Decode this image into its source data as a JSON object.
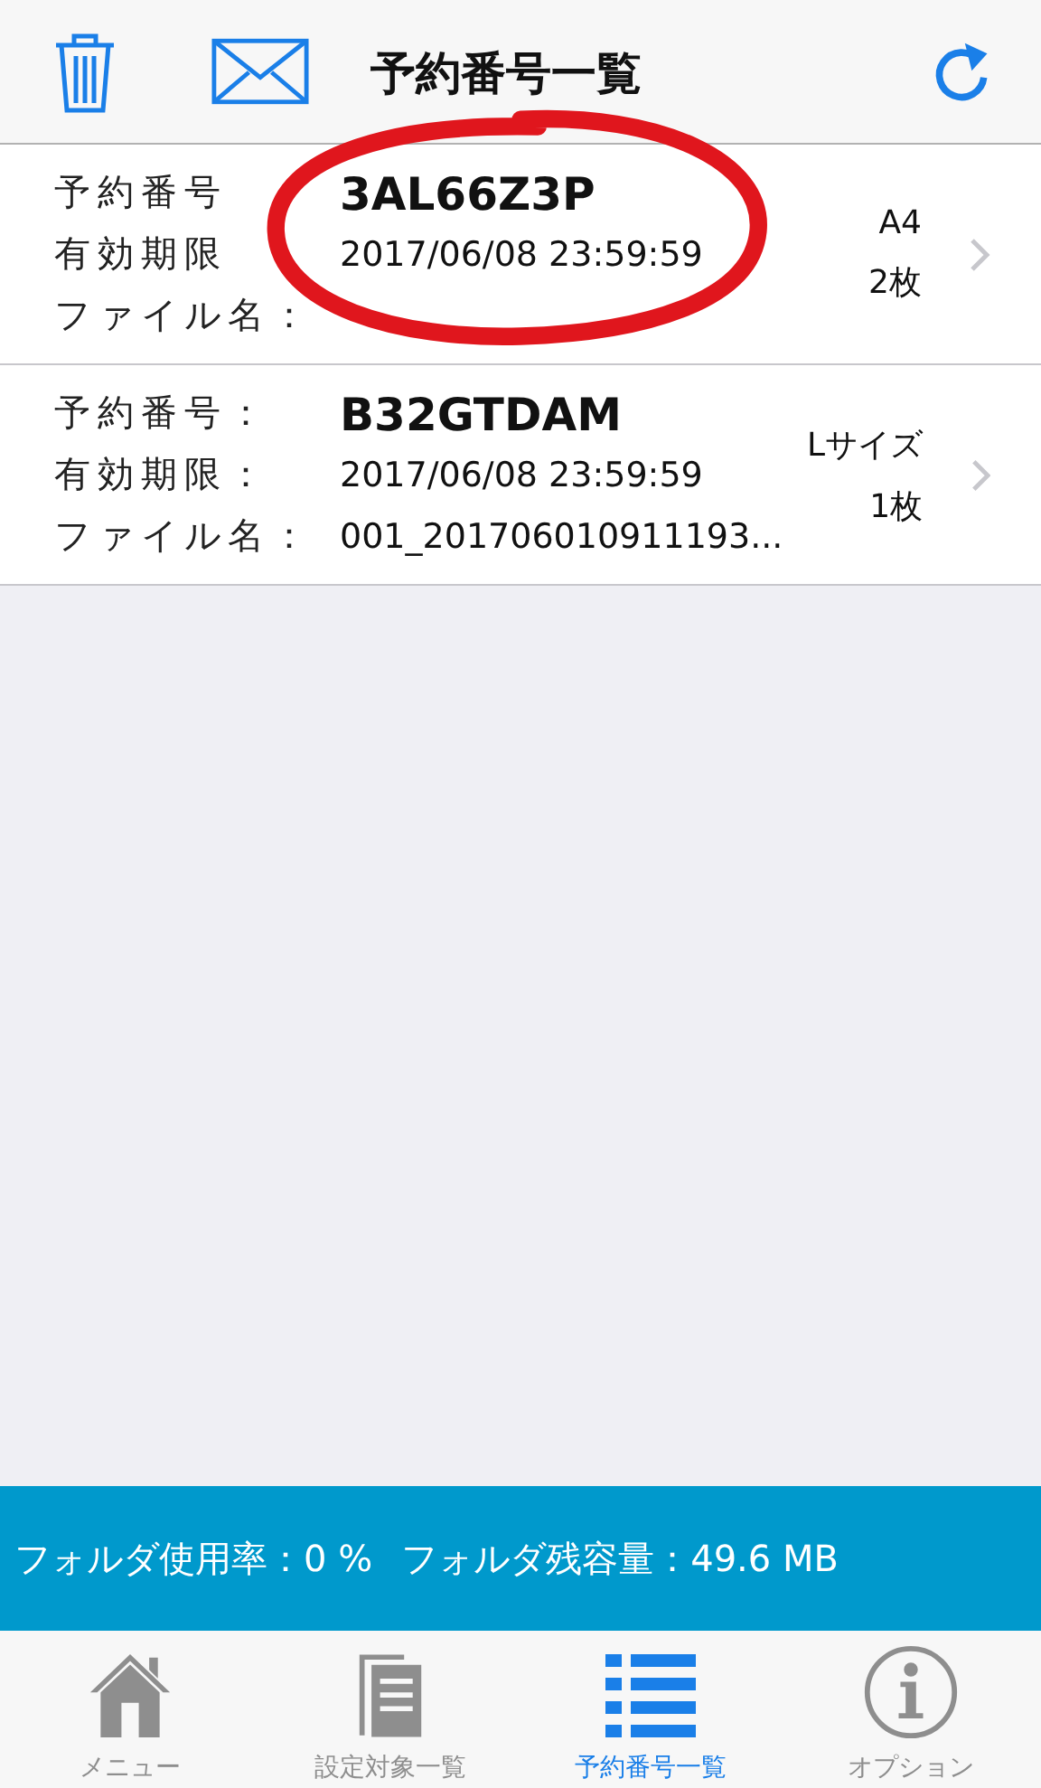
{
  "header": {
    "title": "予約番号一覧"
  },
  "reservations": [
    {
      "labels": [
        "予約番号",
        "有効期限",
        "ファイル名："
      ],
      "number": "3AL66Z3P",
      "expiry": "2017/06/08 23:59:59",
      "size": "A4",
      "count": "2枚",
      "circled": true
    },
    {
      "labels": [
        "予約番号：",
        "有効期限：",
        "ファイル名："
      ],
      "number": "B32GTDAM",
      "expiry": "2017/06/08 23:59:59",
      "file_name": "001_201706010911193...",
      "size": "Lサイズ",
      "count": "1枚",
      "circled": false
    }
  ],
  "status_bar": {
    "usage": "フォルダ使用率：0 %",
    "remaining": "フォルダ残容量：49.6 MB"
  },
  "tabs": [
    {
      "kind": "home",
      "label": "メニュー",
      "selected": false
    },
    {
      "kind": "document",
      "label": "設定対象一覧",
      "selected": false
    },
    {
      "kind": "list",
      "label": "予約番号一覧",
      "selected": true
    },
    {
      "kind": "info",
      "label": "オプション",
      "selected": false
    }
  ]
}
